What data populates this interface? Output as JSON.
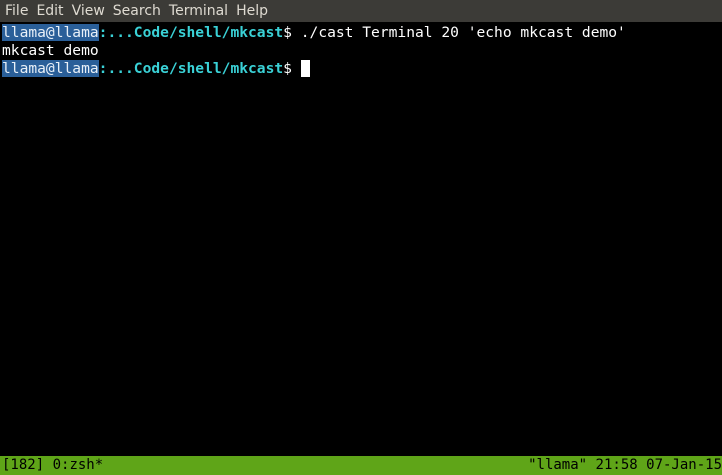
{
  "menubar": {
    "items": [
      "File",
      "Edit",
      "View",
      "Search",
      "Terminal",
      "Help"
    ]
  },
  "terminal": {
    "prompt_user": "llama@llama",
    "prompt_path": ":...Code/shell/mkcast",
    "prompt_symbol": "$",
    "lines": [
      {
        "command": " ./cast Terminal 20 'echo mkcast demo'"
      },
      {
        "output": "mkcast demo"
      },
      {
        "command": " "
      }
    ]
  },
  "statusbar": {
    "session": "[182]",
    "window": "0:zsh*",
    "host": "\"llama\"",
    "time": "21:58",
    "date": "07-Jan-15"
  },
  "colors": {
    "menubar_bg": "#3c3b37",
    "terminal_bg": "#000000",
    "user_highlight": "#2a5f99",
    "path_color": "#3ad1d6",
    "statusbar_bg": "#5fa518"
  }
}
